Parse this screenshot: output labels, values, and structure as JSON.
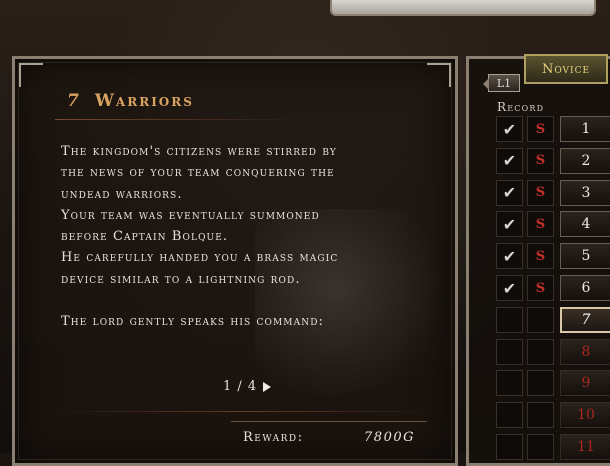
{
  "story": {
    "chapter_number": "7",
    "chapter_title": "Warriors",
    "paragraphs": [
      "The kingdom's citizens were stirred by",
      "the news of your team conquering the",
      "undead warriors.",
      "Your team was eventually summoned",
      "before Captain Bolque.",
      "He carefully handed you a brass magic",
      "device similar to a lightning rod."
    ],
    "command_line": "The lord gently speaks his command:",
    "pager": "1 / 4",
    "reward_label": "Reward:",
    "reward_value": "7800G"
  },
  "records": {
    "difficulty": "Novice",
    "page_tab": "L1",
    "title": "Record",
    "chapters": [
      {
        "label": "1",
        "check": "✔",
        "s": "S"
      },
      {
        "label": "2",
        "check": "✔",
        "s": "S"
      },
      {
        "label": "3",
        "check": "✔",
        "s": "S"
      },
      {
        "label": "4",
        "check": "✔",
        "s": "S"
      },
      {
        "label": "5",
        "check": "✔",
        "s": "S"
      },
      {
        "label": "6",
        "check": "✔",
        "s": "S"
      },
      {
        "label": "7",
        "check": "",
        "s": ""
      },
      {
        "label": "8",
        "check": "",
        "s": ""
      },
      {
        "label": "9",
        "check": "",
        "s": ""
      },
      {
        "label": "10",
        "check": "",
        "s": ""
      },
      {
        "label": "11",
        "check": "",
        "s": ""
      }
    ]
  },
  "colors": {
    "title_gold": "#d8a460",
    "locked_red": "#a8281e",
    "s_red": "#c8302a"
  }
}
